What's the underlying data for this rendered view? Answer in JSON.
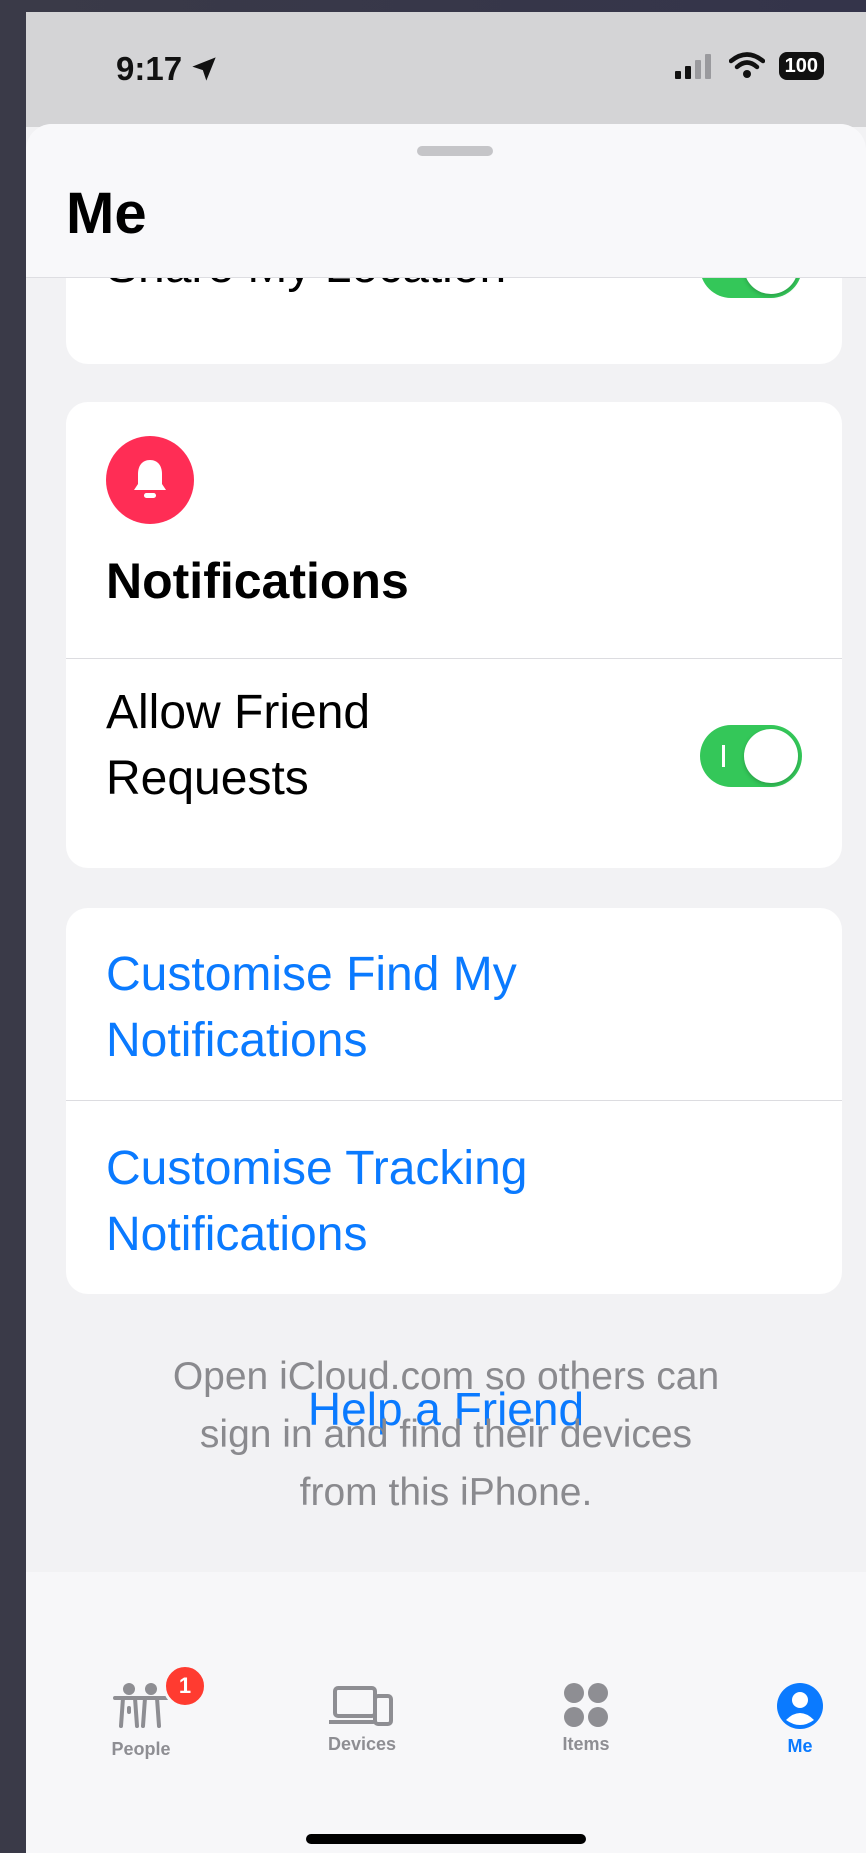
{
  "status_bar": {
    "time": "9:17",
    "battery": "100"
  },
  "sheet": {
    "title": "Me"
  },
  "location": {
    "label": "Share My Location",
    "enabled": true
  },
  "notifications": {
    "heading": "Notifications",
    "allow_friend_requests_line1": "Allow Friend",
    "allow_friend_requests_line2": "Requests",
    "allow_friend_requests_enabled": true,
    "icon_color": "#ff2d55"
  },
  "customise": {
    "find_my_line1": "Customise Find My",
    "find_my_line2": "Notifications",
    "tracking_line1": "Customise Tracking",
    "tracking_line2": "Notifications"
  },
  "help": {
    "title": "Help a Friend",
    "desc_line1": "Open iCloud.com so others can",
    "desc_line2": "sign in and find their devices",
    "desc_line3": "from this iPhone."
  },
  "tabs": [
    {
      "label": "People",
      "icon": "people-icon",
      "badge": "1"
    },
    {
      "label": "Devices",
      "icon": "devices-icon"
    },
    {
      "label": "Items",
      "icon": "items-icon"
    },
    {
      "label": "Me",
      "icon": "me-icon",
      "active": true
    }
  ],
  "colors": {
    "accent": "#0a7aff",
    "toggle_on": "#34c759",
    "badge": "#ff3b30"
  }
}
